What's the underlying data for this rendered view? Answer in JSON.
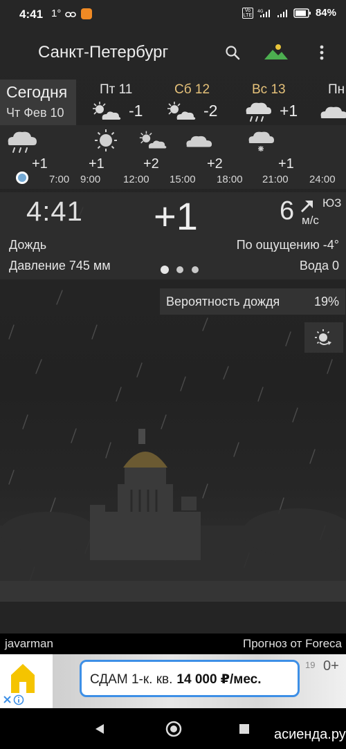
{
  "status_bar": {
    "time": "4:41",
    "temp_indicator": "1°",
    "battery": "84%"
  },
  "toolbar": {
    "city": "Санкт-Петербург",
    "icons": [
      "search-icon",
      "landscape-icon",
      "more-vert-icon"
    ]
  },
  "days": {
    "today_title": "Сегодня",
    "today_date": "Чт Фев 10",
    "items": [
      {
        "name": "Пт 11",
        "temp": "-1",
        "icon": "partly-cloudy-icon",
        "color": "#e6e6e6"
      },
      {
        "name": "Сб 12",
        "temp": "-2",
        "icon": "partly-cloudy-icon",
        "color": "#e6c27a"
      },
      {
        "name": "Вс 13",
        "temp": "+1",
        "icon": "rain-cloud-icon",
        "color": "#e6c27a"
      },
      {
        "name": "Пн",
        "temp": "",
        "icon": "cloud-icon",
        "color": "#e6e6e6"
      }
    ]
  },
  "hourly": {
    "temps": [
      "+1",
      "+1",
      "+2",
      "+2",
      "+1"
    ],
    "times": [
      "7:00",
      "9:00",
      "12:00",
      "15:00",
      "18:00",
      "21:00",
      "24:00"
    ],
    "icons": [
      "rain-cloud-icon",
      "sun-icon",
      "partly-cloudy-icon",
      "cloud-icon",
      "snow-cloud-icon"
    ]
  },
  "current": {
    "time": "4:41",
    "temp": "+1",
    "wind_speed": "6",
    "wind_dir": "ЮЗ",
    "wind_unit": "м/с",
    "condition": "Дождь",
    "feels_like": "По ощущению -4°",
    "pressure": "Давление 745 мм",
    "water": "Вода 0"
  },
  "rain_probability": {
    "label": "Вероятность дождя",
    "value": "19%"
  },
  "credits": {
    "author": "javarman",
    "provider": "Прогноз от Foreca"
  },
  "ad": {
    "text": "СДАМ 1-к. кв.",
    "price": "14 000 ₽/мес.",
    "side_small": "19",
    "side_large": "0+"
  },
  "watermark": "асиенда.ру"
}
